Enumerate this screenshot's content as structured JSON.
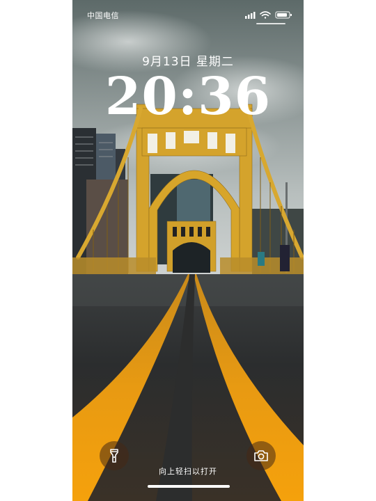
{
  "status_bar": {
    "carrier": "中国电信",
    "signal_icon": "cellular-signal-icon",
    "wifi_icon": "wifi-icon",
    "battery_icon": "battery-icon"
  },
  "lock_screen": {
    "date": "9月13日 星期二",
    "time": "20:36",
    "unlock_hint": "向上轻扫以打开",
    "shortcuts": {
      "left_icon": "flashlight-icon",
      "right_icon": "camera-icon"
    }
  },
  "wallpaper": {
    "subject": "yellow-suspension-bridge-road",
    "colors": {
      "sky": "#6e7978",
      "bridge": "#d6a52a",
      "road": "#2f3030",
      "lane_line": "#f0a010"
    }
  }
}
